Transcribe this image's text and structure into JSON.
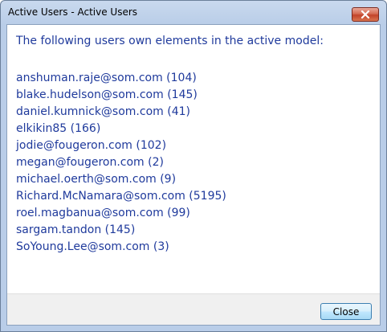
{
  "window": {
    "title": "Active Users - Active Users",
    "close_icon": "close-x-icon"
  },
  "main": {
    "heading": "The following users own elements in the active model:",
    "users": [
      "anshuman.raje@som.com (104)",
      "blake.hudelson@som.com (145)",
      "daniel.kumnick@som.com (41)",
      "elkikin85 (166)",
      "jodie@fougeron.com (102)",
      "megan@fougeron.com (2)",
      "michael.oerth@som.com (9)",
      "Richard.McNamara@som.com (5195)",
      "roel.magbanua@som.com (99)",
      "sargam.tandon (145)",
      "SoYoung.Lee@som.com (3)"
    ]
  },
  "footer": {
    "close_label": "Close"
  },
  "colors": {
    "text_blue": "#1f3a9c",
    "title_close_red": "#c2432a",
    "button_border": "#3c7fb1"
  }
}
